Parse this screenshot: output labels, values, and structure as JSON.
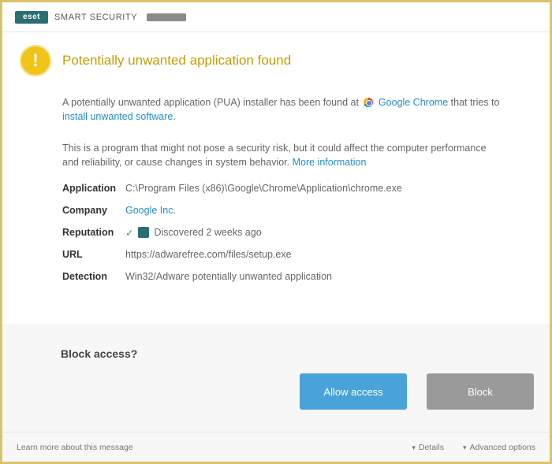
{
  "window": {
    "logo_text": "eset",
    "brand": "SMART SECURITY"
  },
  "dialog": {
    "title": "Potentially unwanted application found",
    "paragraph1_pre": "A potentially unwanted application (PUA) installer has been found at",
    "paragraph1_app": "Google Chrome",
    "paragraph1_post": "that tries to",
    "paragraph1_link": "install unwanted software",
    "paragraph1_end": ".",
    "paragraph2_text": "This is a program that might not pose a security risk, but it could affect the computer performance and reliability, or cause changes in system behavior.",
    "paragraph2_link": "More information",
    "details": [
      {
        "key": "Application",
        "value": "C:\\Program Files (x86)\\Google\\Chrome\\Application\\chrome.exe",
        "link": false
      },
      {
        "key": "Company",
        "value": "Google Inc.",
        "link": true
      },
      {
        "key": "Reputation",
        "value": "Discovered 2 weeks ago",
        "link": false
      },
      {
        "key": "URL",
        "value": "https://adwarefree.com/files/setup.exe",
        "link": false
      },
      {
        "key": "Detection",
        "value": "Win32/Adware potentially unwanted application",
        "link": false
      }
    ],
    "question": "Block access?",
    "buttons": {
      "primary": "Allow access",
      "secondary": "Block"
    }
  },
  "statusbar": {
    "left": "Learn more about this message",
    "details": "Details",
    "advanced": "Advanced options"
  },
  "colors": {
    "accent": "#4aa3d8",
    "warning": "#f0c419",
    "title": "#c89c00",
    "link": "#1f8fcf"
  },
  "icons": {
    "warning": "warning-icon",
    "browser": "chrome-icon",
    "reputation": "reputation-check-icon",
    "chevron": "chevron-down-icon"
  }
}
